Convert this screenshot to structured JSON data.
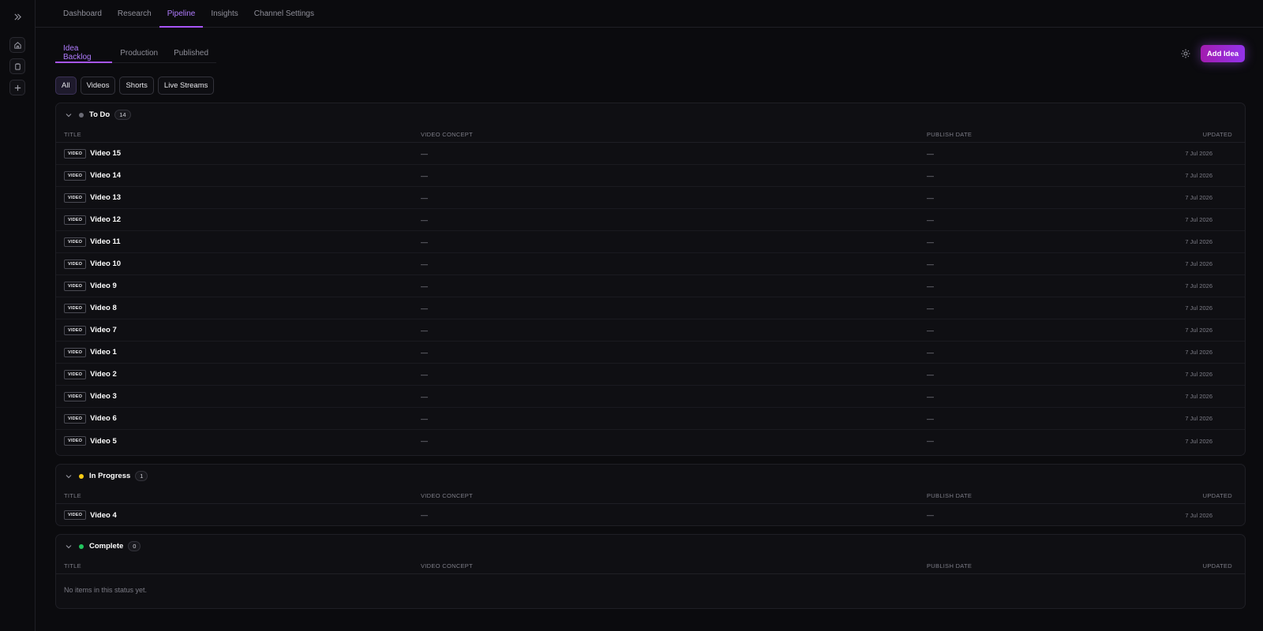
{
  "rail": {
    "icons": [
      "expand-icon",
      "home-icon",
      "clipboard-icon",
      "plus-icon"
    ]
  },
  "topnav": {
    "tabs": [
      "Dashboard",
      "Research",
      "Pipeline",
      "Insights",
      "Channel Settings"
    ],
    "active": "Pipeline"
  },
  "subtabs": {
    "tabs": [
      "Idea Backlog",
      "Production",
      "Published"
    ],
    "active": "Idea Backlog"
  },
  "actions": {
    "add_label": "Add Idea"
  },
  "filters": [
    "All",
    "Videos",
    "Shorts",
    "Live Streams"
  ],
  "columns": {
    "title": "TITLE",
    "concept": "VIDEO CONCEPT",
    "date": "PUBLISH DATE",
    "updated": "UPDATED"
  },
  "sections": {
    "todo": {
      "title": "To Do",
      "count": "14",
      "color": "#6b6b75",
      "rows": [
        {
          "badge": "VIDEO",
          "title": "Video 15",
          "concept": "—",
          "date": "—",
          "updated": "7 Jul 2026"
        },
        {
          "badge": "VIDEO",
          "title": "Video 14",
          "concept": "—",
          "date": "—",
          "updated": "7 Jul 2026"
        },
        {
          "badge": "VIDEO",
          "title": "Video 13",
          "concept": "—",
          "date": "—",
          "updated": "7 Jul 2026"
        },
        {
          "badge": "VIDEO",
          "title": "Video 12",
          "concept": "—",
          "date": "—",
          "updated": "7 Jul 2026"
        },
        {
          "badge": "VIDEO",
          "title": "Video 11",
          "concept": "—",
          "date": "—",
          "updated": "7 Jul 2026"
        },
        {
          "badge": "VIDEO",
          "title": "Video 10",
          "concept": "—",
          "date": "—",
          "updated": "7 Jul 2026"
        },
        {
          "badge": "VIDEO",
          "title": "Video 9",
          "concept": "—",
          "date": "—",
          "updated": "7 Jul 2026"
        },
        {
          "badge": "VIDEO",
          "title": "Video 8",
          "concept": "—",
          "date": "—",
          "updated": "7 Jul 2026"
        },
        {
          "badge": "VIDEO",
          "title": "Video 7",
          "concept": "—",
          "date": "—",
          "updated": "7 Jul 2026"
        },
        {
          "badge": "VIDEO",
          "title": "Video 1",
          "concept": "—",
          "date": "—",
          "updated": "7 Jul 2026"
        },
        {
          "badge": "VIDEO",
          "title": "Video 2",
          "concept": "—",
          "date": "—",
          "updated": "7 Jul 2026"
        },
        {
          "badge": "VIDEO",
          "title": "Video 3",
          "concept": "—",
          "date": "—",
          "updated": "7 Jul 2026"
        },
        {
          "badge": "VIDEO",
          "title": "Video 6",
          "concept": "—",
          "date": "—",
          "updated": "7 Jul 2026"
        },
        {
          "badge": "VIDEO",
          "title": "Video 5",
          "concept": "—",
          "date": "—",
          "updated": "7 Jul 2026"
        }
      ]
    },
    "inprogress": {
      "title": "In Progress",
      "count": "1",
      "color": "#facc15",
      "rows": [
        {
          "badge": "VIDEO",
          "title": "Video 4",
          "concept": "—",
          "date": "—",
          "updated": "7 Jul 2026"
        }
      ]
    },
    "complete": {
      "title": "Complete",
      "count": "0",
      "color": "#22c55e",
      "rows": [],
      "empty_text": "No items in this status yet."
    }
  },
  "colors": {
    "accent": "#a855f7",
    "background": "#0b0b0e"
  }
}
